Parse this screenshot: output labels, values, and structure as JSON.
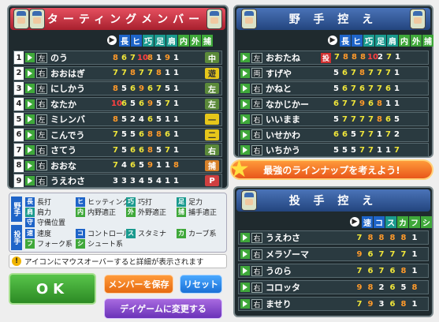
{
  "starting": {
    "title": "スターティングメンバー",
    "attrs": [
      "長",
      "ヒ",
      "巧",
      "足",
      "肩",
      "内",
      "外",
      "捕"
    ],
    "rows": [
      {
        "num": "1",
        "hand": "左",
        "name": "のう",
        "stats": [
          "8",
          "6",
          "7",
          "10",
          "8",
          "1",
          "9",
          "1"
        ],
        "pos": "中"
      },
      {
        "num": "2",
        "hand": "右",
        "name": "おおはぎ",
        "stats": [
          "7",
          "7",
          "8",
          "7",
          "7",
          "8",
          "1",
          "1"
        ],
        "pos": "遊"
      },
      {
        "num": "3",
        "hand": "左",
        "name": "にしかう",
        "stats": [
          "8",
          "5",
          "6",
          "9",
          "6",
          "7",
          "5",
          "1"
        ],
        "pos": "左"
      },
      {
        "num": "4",
        "hand": "右",
        "name": "なたか",
        "stats": [
          "10",
          "6",
          "5",
          "6",
          "9",
          "5",
          "7",
          "1"
        ],
        "pos": "左"
      },
      {
        "num": "5",
        "hand": "左",
        "name": "ミレンバ",
        "stats": [
          "8",
          "5",
          "2",
          "4",
          "6",
          "5",
          "1",
          "1"
        ],
        "pos": "一"
      },
      {
        "num": "6",
        "hand": "左",
        "name": "こんでう",
        "stats": [
          "7",
          "5",
          "5",
          "6",
          "8",
          "8",
          "6",
          "1"
        ],
        "pos": "二"
      },
      {
        "num": "7",
        "hand": "右",
        "name": "さてう",
        "stats": [
          "7",
          "5",
          "6",
          "6",
          "8",
          "5",
          "7",
          "1"
        ],
        "pos": "右"
      },
      {
        "num": "8",
        "hand": "右",
        "name": "おおな",
        "stats": [
          "7",
          "4",
          "6",
          "5",
          "9",
          "1",
          "1",
          "8"
        ],
        "pos": "捕"
      },
      {
        "num": "9",
        "hand": "右",
        "name": "うえわさ",
        "stats": [
          "3",
          "3",
          "3",
          "4",
          "5",
          "4",
          "1",
          "1"
        ],
        "pos": "P"
      }
    ]
  },
  "bench": {
    "title": "野 手 控 え",
    "attrs": [
      "長",
      "ヒ",
      "巧",
      "足",
      "肩",
      "内",
      "外",
      "捕"
    ],
    "rows": [
      {
        "hand": "左",
        "name": "おおたね",
        "tag": "投",
        "stats": [
          "7",
          "8",
          "8",
          "8",
          "10",
          "2",
          "7",
          "1"
        ]
      },
      {
        "hand": "両",
        "name": "すげや",
        "tag": "",
        "stats": [
          "5",
          "6",
          "7",
          "8",
          "7",
          "7",
          "7",
          "1"
        ]
      },
      {
        "hand": "右",
        "name": "かねと",
        "tag": "",
        "stats": [
          "5",
          "6",
          "7",
          "6",
          "7",
          "7",
          "6",
          "1"
        ]
      },
      {
        "hand": "左",
        "name": "なかじかー",
        "tag": "",
        "stats": [
          "6",
          "7",
          "7",
          "9",
          "6",
          "8",
          "1",
          "1"
        ]
      },
      {
        "hand": "右",
        "name": "いいまま",
        "tag": "",
        "stats": [
          "5",
          "7",
          "7",
          "7",
          "7",
          "8",
          "6",
          "5"
        ]
      },
      {
        "hand": "右",
        "name": "いせかわ",
        "tag": "",
        "stats": [
          "6",
          "6",
          "5",
          "7",
          "7",
          "1",
          "7",
          "2"
        ]
      },
      {
        "hand": "右",
        "name": "いちかう",
        "tag": "",
        "stats": [
          "5",
          "5",
          "5",
          "7",
          "7",
          "1",
          "1",
          "7"
        ]
      }
    ]
  },
  "banner": "最強のラインナップを考えよう!",
  "pitchers": {
    "title": "投 手 控 え",
    "attrs": [
      "速",
      "コ",
      "ス",
      "カ",
      "フ",
      "シ"
    ],
    "rows": [
      {
        "hand": "右",
        "name": "うえわさ",
        "stats": [
          "7",
          "8",
          "8",
          "8",
          "8",
          "1"
        ]
      },
      {
        "hand": "右",
        "name": "メラゾーマ",
        "stats": [
          "9",
          "6",
          "7",
          "7",
          "7",
          "1"
        ]
      },
      {
        "hand": "右",
        "name": "うのら",
        "stats": [
          "7",
          "6",
          "7",
          "6",
          "8",
          "1"
        ]
      },
      {
        "hand": "右",
        "name": "コロッタ",
        "stats": [
          "9",
          "8",
          "2",
          "6",
          "5",
          "8"
        ]
      },
      {
        "hand": "右",
        "name": "ませり",
        "stats": [
          "7",
          "9",
          "3",
          "6",
          "8",
          "1"
        ]
      }
    ]
  },
  "legend": {
    "fielder_head": "野手",
    "pitcher_head": "投手",
    "fielder_items": [
      {
        "tag": "長",
        "label": "長打",
        "color": "#1e64c8"
      },
      {
        "tag": "ヒ",
        "label": "ヒッティング",
        "color": "#1e64c8"
      },
      {
        "tag": "巧",
        "label": "巧打",
        "color": "#1a9a8e"
      },
      {
        "tag": "足",
        "label": "足力",
        "color": "#1a9a8e"
      },
      {
        "tag": "肩",
        "label": "肩力",
        "color": "#1a9a8e"
      },
      {
        "tag": "内",
        "label": "内野適正",
        "color": "#3fa83a"
      },
      {
        "tag": "外",
        "label": "外野適正",
        "color": "#3fa83a"
      },
      {
        "tag": "捕",
        "label": "捕手適正",
        "color": "#3fa83a"
      },
      {
        "tag": "守",
        "label": "守備位置",
        "color": "#1e64c8"
      }
    ],
    "pitcher_items": [
      {
        "tag": "速",
        "label": "速度",
        "color": "#1e64c8"
      },
      {
        "tag": "コ",
        "label": "コントロール",
        "color": "#1e64c8"
      },
      {
        "tag": "ス",
        "label": "スタミナ",
        "color": "#1a9a8e"
      },
      {
        "tag": "カ",
        "label": "カーブ系",
        "color": "#3fa83a"
      },
      {
        "tag": "フ",
        "label": "フォーク系",
        "color": "#3fa83a"
      },
      {
        "tag": "シ",
        "label": "シュート系",
        "color": "#3fa83a"
      }
    ]
  },
  "notice": "アイコンにマウスオーバーすると詳細が表示されます",
  "buttons": {
    "ok": "OK",
    "save": "メンバーを保存",
    "reset": "リセット",
    "day": "デイゲームに変更する"
  }
}
